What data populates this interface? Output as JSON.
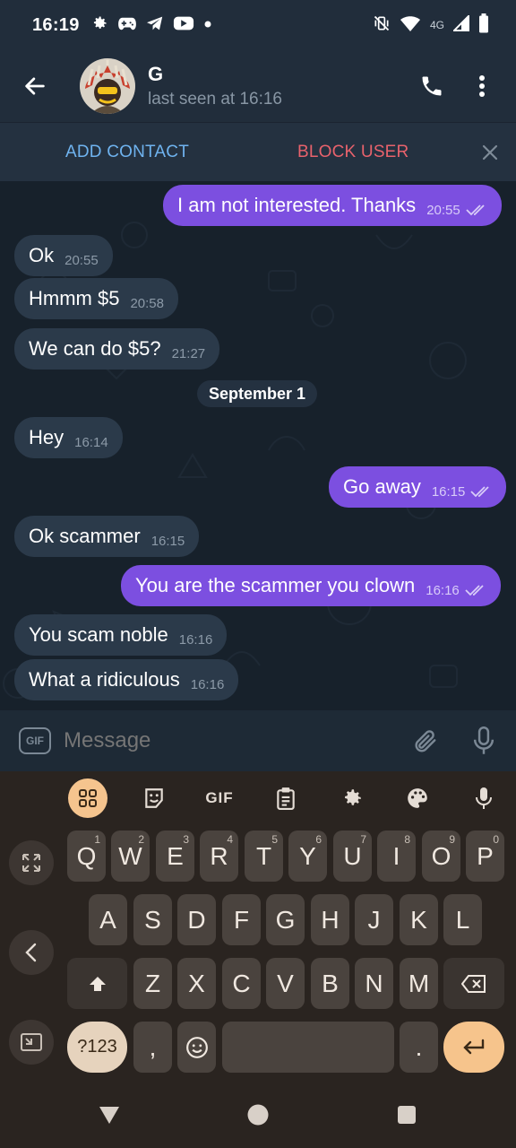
{
  "status_bar": {
    "time": "16:19",
    "network_label": "4G",
    "left_icons": [
      "gear-icon",
      "game-controller-icon",
      "telegram-icon",
      "youtube-icon",
      "dot-icon"
    ],
    "right_icons": [
      "mute-vibrate-icon",
      "wifi-icon",
      "signal-icon",
      "battery-icon"
    ]
  },
  "header": {
    "contact_name": "G",
    "last_seen": "last seen at 16:16"
  },
  "action_bar": {
    "add_contact": "ADD CONTACT",
    "block_user": "BLOCK USER"
  },
  "messages": [
    {
      "dir": "out",
      "text": "I am not interested. Thanks",
      "time": "20:55",
      "read": true
    },
    {
      "dir": "in",
      "text": "Ok",
      "time": "20:55"
    },
    {
      "dir": "in",
      "text": "Hmmm $5",
      "time": "20:58"
    },
    {
      "dir": "in",
      "text": "We can do $5?",
      "time": "21:27"
    },
    {
      "dir": "date",
      "text": "September 1"
    },
    {
      "dir": "in",
      "text": "Hey",
      "time": "16:14"
    },
    {
      "dir": "out",
      "text": "Go away",
      "time": "16:15",
      "read": true
    },
    {
      "dir": "in",
      "text": "Ok scammer",
      "time": "16:15"
    },
    {
      "dir": "out",
      "text": "You are the scammer you clown",
      "time": "16:16",
      "read": true
    },
    {
      "dir": "in",
      "text": "You scam noble",
      "time": "16:16"
    },
    {
      "dir": "in",
      "text": "What a ridiculous",
      "time": "16:16"
    }
  ],
  "composer": {
    "gif_label": "GIF",
    "placeholder": "Message"
  },
  "keyboard": {
    "toolbar": {
      "gif_label": "GIF"
    },
    "row1": [
      {
        "k": "Q",
        "n": "1"
      },
      {
        "k": "W",
        "n": "2"
      },
      {
        "k": "E",
        "n": "3"
      },
      {
        "k": "R",
        "n": "4"
      },
      {
        "k": "T",
        "n": "5"
      },
      {
        "k": "Y",
        "n": "6"
      },
      {
        "k": "U",
        "n": "7"
      },
      {
        "k": "I",
        "n": "8"
      },
      {
        "k": "O",
        "n": "9"
      },
      {
        "k": "P",
        "n": "0"
      }
    ],
    "row2": [
      "A",
      "S",
      "D",
      "F",
      "G",
      "H",
      "J",
      "K",
      "L"
    ],
    "row3": [
      "Z",
      "X",
      "C",
      "V",
      "B",
      "N",
      "M"
    ],
    "symbols_key": "?123",
    "comma_key": ",",
    "period_key": ".",
    "accent_color": "#f6c48c"
  }
}
